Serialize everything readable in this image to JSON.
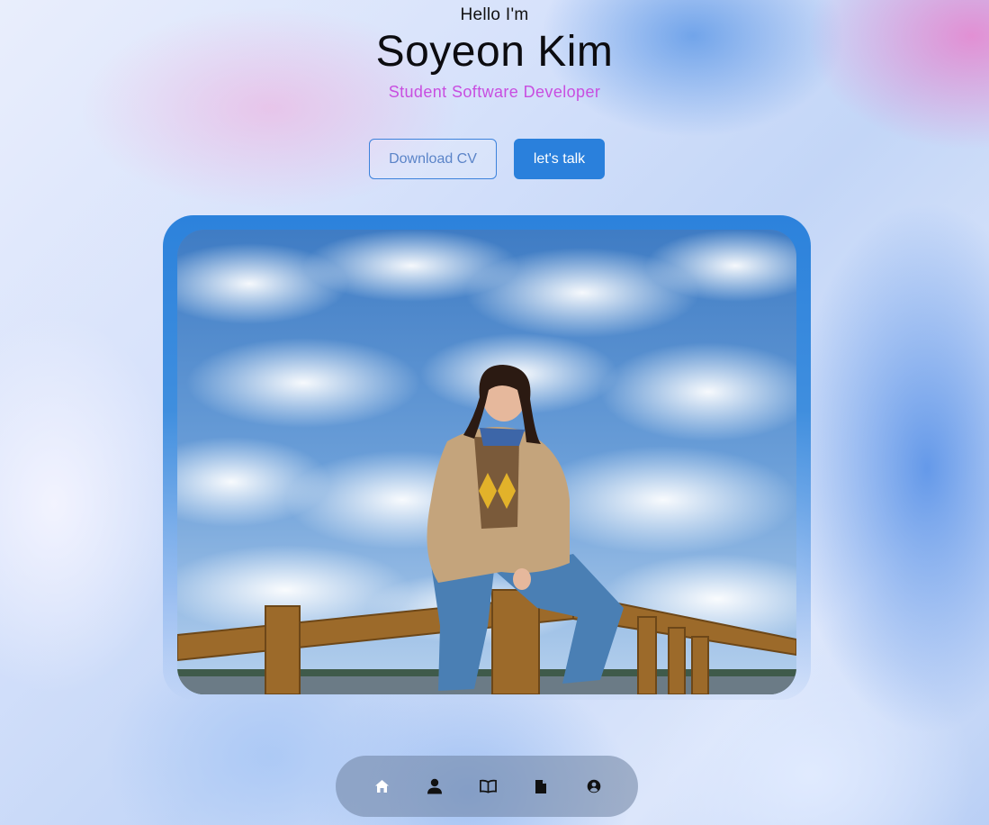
{
  "hero": {
    "greeting": "Hello I'm",
    "name": "Soyeon Kim",
    "title": "Student Software Developer"
  },
  "actions": {
    "download_label": "Download CV",
    "talk_label": "let's talk"
  },
  "photo": {
    "alt": "Portrait of Soyeon Kim sitting on a wooden railing under a cloudy blue sky"
  },
  "nav": {
    "items": [
      {
        "icon": "home-icon"
      },
      {
        "icon": "user-icon"
      },
      {
        "icon": "book-icon"
      },
      {
        "icon": "document-icon"
      },
      {
        "icon": "user-circle-icon"
      }
    ]
  },
  "colors": {
    "accent": "#2a80dc",
    "subtitle": "#c84ee0",
    "nav_background": "rgba(110,130,160,0.55)"
  }
}
